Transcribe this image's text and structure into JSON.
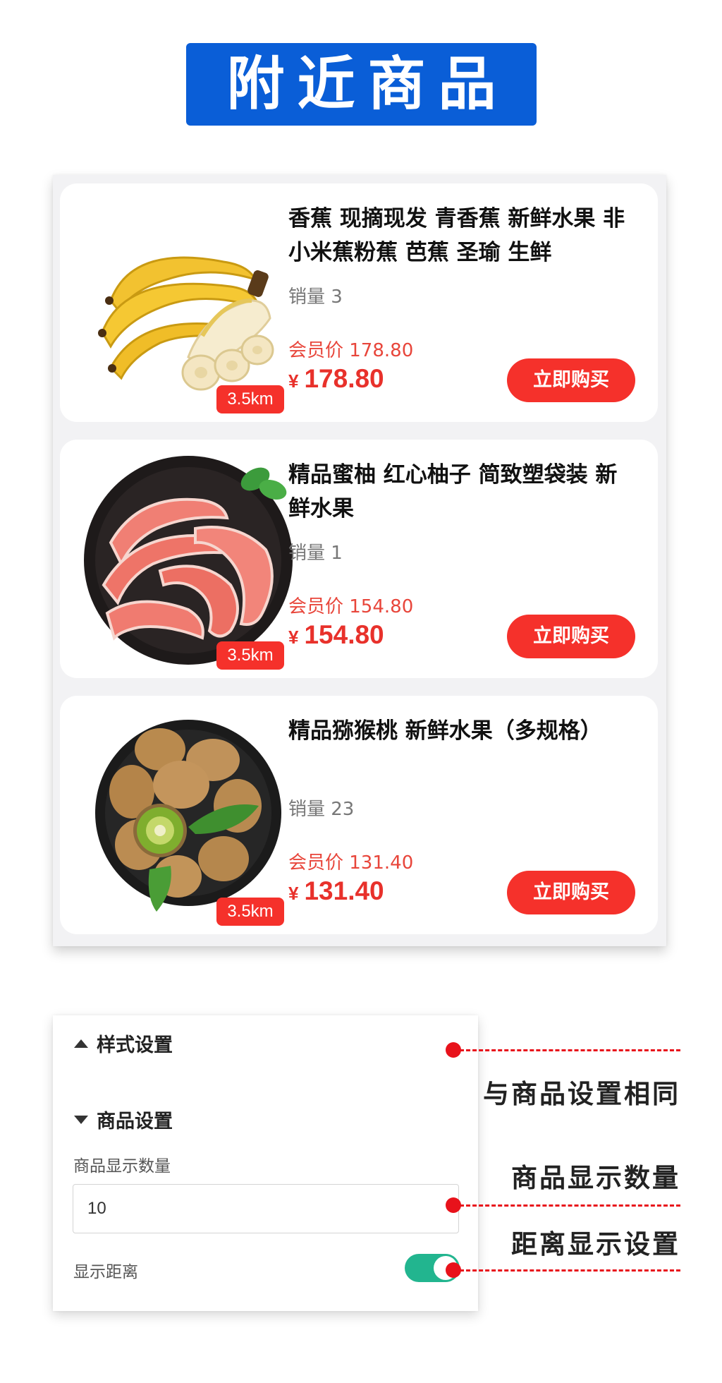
{
  "banner": {
    "title": "附近商品"
  },
  "products": [
    {
      "title": "香蕉 现摘现发 青香蕉 新鲜水果 非小米蕉粉蕉 芭蕉 圣瑜 生鲜",
      "sales": "销量 3",
      "member_price": "会员价 178.80",
      "currency": "¥",
      "price": "178.80",
      "distance": "3.5km",
      "buy_label": "立即购买",
      "image": "banana"
    },
    {
      "title": "精品蜜柚 红心柚子 简致塑袋装 新鲜水果",
      "sales": "销量 1",
      "member_price": "会员价 154.80",
      "currency": "¥",
      "price": "154.80",
      "distance": "3.5km",
      "buy_label": "立即购买",
      "image": "pomelo"
    },
    {
      "title": "精品猕猴桃 新鲜水果（多规格）",
      "sales": "销量 23",
      "member_price": "会员价 131.40",
      "currency": "¥",
      "price": "131.40",
      "distance": "3.5km",
      "buy_label": "立即购买",
      "image": "kiwi"
    }
  ],
  "settings": {
    "style_section": "样式设置",
    "product_section": "商品设置",
    "count_label": "商品显示数量",
    "count_value": "10",
    "distance_label": "显示距离",
    "distance_enabled": true
  },
  "annotations": {
    "style_note": "与商品设置相同",
    "count_note": "商品显示数量",
    "distance_note": "距离显示设置"
  },
  "colors": {
    "banner_blue": "#0a5ed7",
    "price_red": "#f5312b",
    "toggle_green": "#22b58f",
    "annotation_red": "#e8121b"
  }
}
